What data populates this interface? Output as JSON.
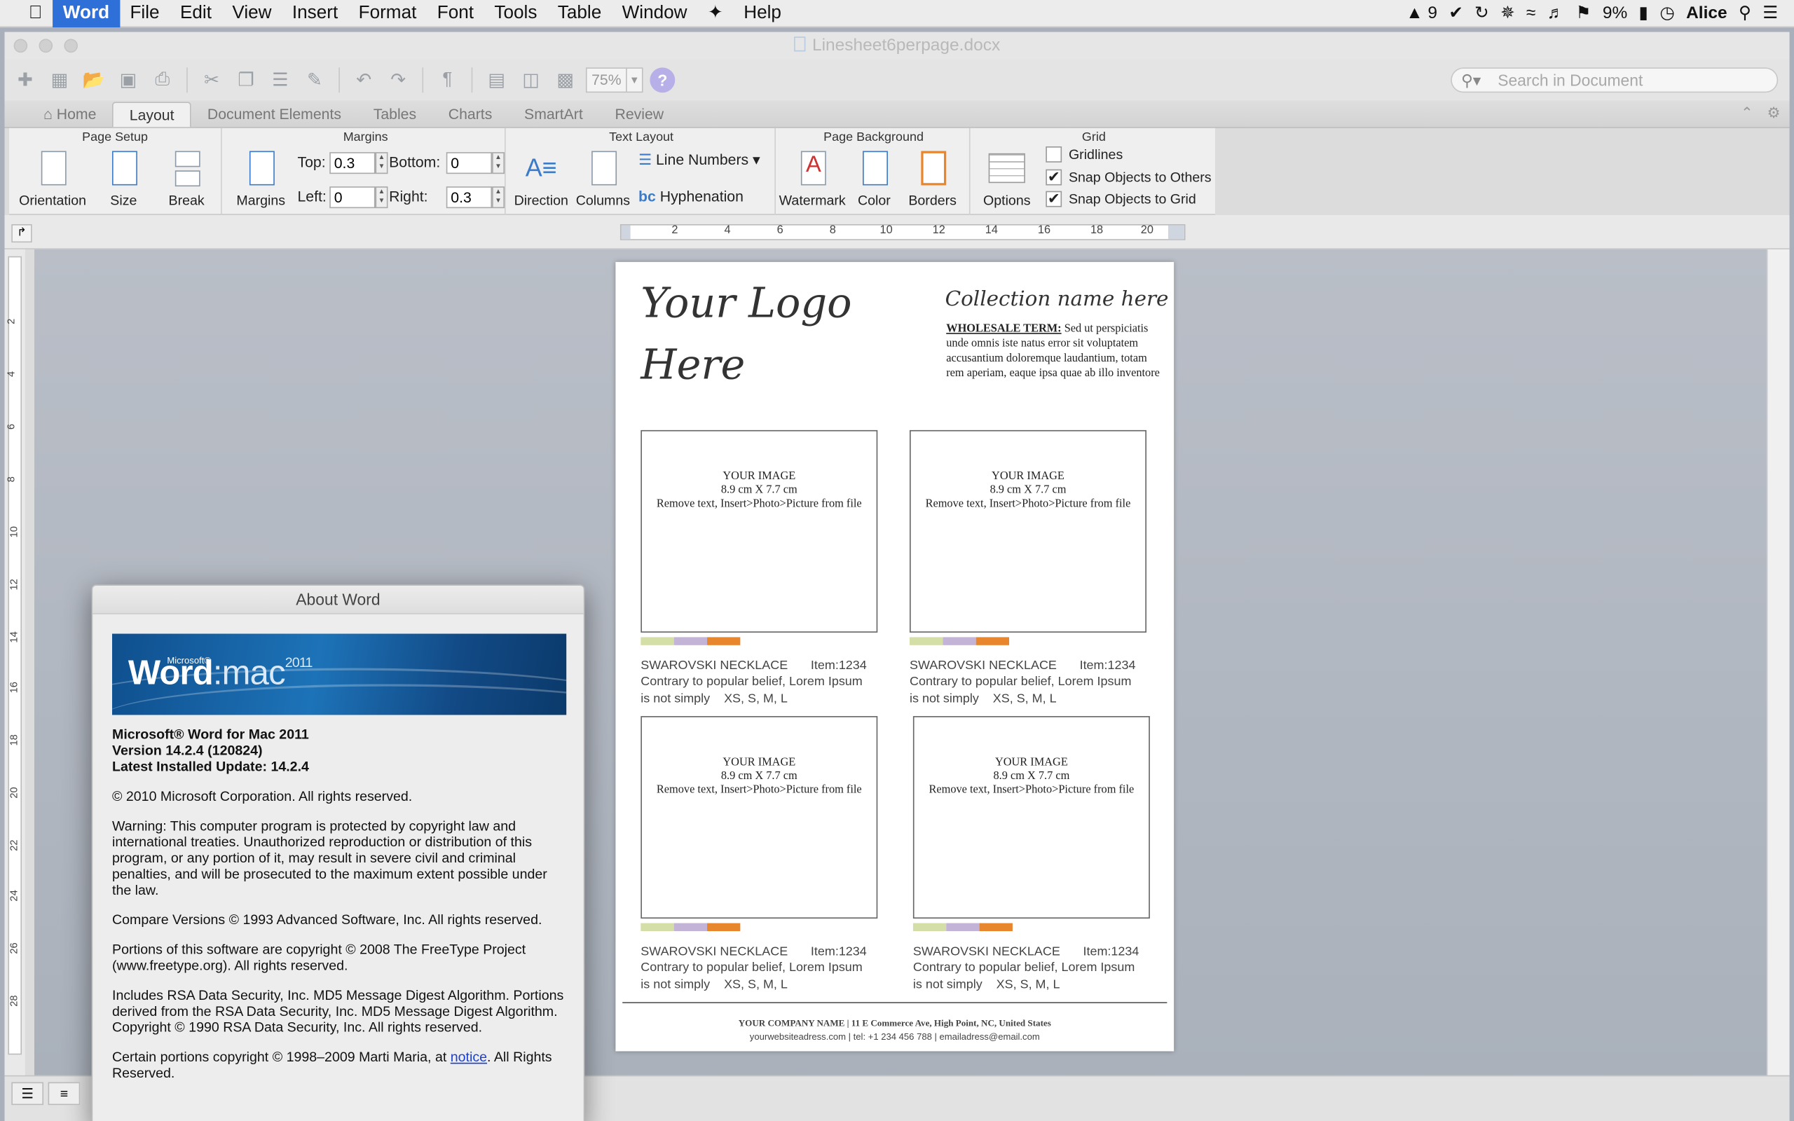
{
  "menubar": {
    "app": "Word",
    "items": [
      "File",
      "Edit",
      "View",
      "Insert",
      "Format",
      "Font",
      "Tools",
      "Table",
      "Window",
      "Help"
    ],
    "status": {
      "adobe": "9",
      "battery": "9%",
      "user": "Alice"
    }
  },
  "window": {
    "title": "Linesheet6perpage.docx",
    "zoom": "75%",
    "search_placeholder": "Search in Document"
  },
  "tabs": [
    "Home",
    "Layout",
    "Document Elements",
    "Tables",
    "Charts",
    "SmartArt",
    "Review"
  ],
  "ribbon": {
    "page_setup": {
      "title": "Page Setup",
      "orientation": "Orientation",
      "size": "Size",
      "break": "Break"
    },
    "margins": {
      "title": "Margins",
      "button": "Margins",
      "top_label": "Top:",
      "top": "0.3",
      "bottom_label": "Bottom:",
      "bottom": "0",
      "left_label": "Left:",
      "left": "0",
      "right_label": "Right:",
      "right": "0.3"
    },
    "text_layout": {
      "title": "Text Layout",
      "direction": "Direction",
      "columns": "Columns",
      "line_numbers": "Line Numbers",
      "hyphenation": "Hyphenation"
    },
    "page_background": {
      "title": "Page Background",
      "watermark": "Watermark",
      "color": "Color",
      "borders": "Borders"
    },
    "grid": {
      "title": "Grid",
      "options": "Options",
      "gridlines": "Gridlines",
      "snap_others": "Snap Objects to Others",
      "snap_grid": "Snap Objects to Grid"
    }
  },
  "ruler": {
    "h_numbers": [
      "2",
      "4",
      "6",
      "8",
      "10",
      "12",
      "14",
      "16",
      "18",
      "20"
    ],
    "v_numbers": [
      "2",
      "4",
      "6",
      "8",
      "10",
      "12",
      "14",
      "16",
      "18",
      "20",
      "22",
      "24",
      "26",
      "28"
    ]
  },
  "document": {
    "logo_line1": "Your Logo",
    "logo_line2": "Here",
    "collection": "Collection name here",
    "wholesale_label": "WHOLESALE TERM:",
    "wholesale_text": " Sed ut perspiciatis unde omnis iste natus error sit voluptatem accusantium doloremque laudantium, totam rem aperiam, eaque ipsa quae ab illo inventore",
    "products": [
      {
        "img1": "YOUR IMAGE",
        "img2": "8.9 cm X 7.7 cm",
        "img3": "Remove text, Insert>Photo>Picture from file",
        "name": "SWAROVSKI NECKLACE",
        "item": "Item:1234",
        "desc1": "Contrary to popular belief, Lorem Ipsum",
        "desc2": "is not simply    XS, S, M, L"
      },
      {
        "img1": "YOUR IMAGE",
        "img2": "8.9 cm X 7.7 cm",
        "img3": "Remove text, Insert>Photo>Picture from file",
        "name": "SWAROVSKI NECKLACE",
        "item": "Item:1234",
        "desc1": "Contrary to popular belief, Lorem Ipsum",
        "desc2": "is not simply    XS, S, M, L"
      },
      {
        "img1": "YOUR IMAGE",
        "img2": "8.9 cm X 7.7 cm",
        "img3": "Remove text, Insert>Photo>Picture from file",
        "name": "SWAROVSKI NECKLACE",
        "item": "Item:1234",
        "desc1": "Contrary to popular belief, Lorem Ipsum",
        "desc2": "is not simply    XS, S, M, L"
      },
      {
        "img1": "YOUR IMAGE",
        "img2": "8.9 cm X 7.7 cm",
        "img3": "Remove text, Insert>Photo>Picture from file",
        "name": "SWAROVSKI NECKLACE",
        "item": "Item:1234",
        "desc1": "Contrary to popular belief, Lorem Ipsum",
        "desc2": "is not simply    XS, S, M, L"
      }
    ],
    "swatch_colors": [
      "#d4dfa8",
      "#c3b3d6",
      "#e8862e"
    ],
    "footer_line1": "YOUR COMPANY NAME  |  11 E Commerce Ave, High Point, NC, United States",
    "footer_line2": "yourwebsiteadress.com  |  tel: +1 234 456 788  |  emailadress@email.com"
  },
  "about": {
    "title": "About Word",
    "banner_ms": "Microsoft®",
    "banner_word": "Word",
    "banner_mac": ":mac",
    "banner_year": "2011",
    "product": "Microsoft® Word for Mac 2011",
    "version": "Version 14.2.4 (120824)",
    "update": "Latest Installed Update: 14.2.4",
    "copyright": "© 2010 Microsoft Corporation. All rights reserved.",
    "warning": "Warning: This computer program is protected by copyright law and international treaties.  Unauthorized reproduction or distribution of this program, or any portion of it, may result in severe civil and criminal penalties, and will be prosecuted to the maximum extent possible under the law.",
    "compare": "Compare Versions © 1993 Advanced Software, Inc.  All rights reserved.",
    "freetype": "Portions of this software are copyright © 2008 The FreeType Project (www.freetype.org).  All rights reserved.",
    "rsa": "Includes RSA Data Security, Inc. MD5 Message Digest Algorithm. Portions derived from the RSA Data Security, Inc. MD5 Message Digest Algorithm.  Copyright © 1990 RSA Data Security, Inc. All rights reserved.",
    "marti_pre": "Certain portions copyright © 1998–2009  Marti Maria, at ",
    "marti_link": "notice",
    "marti_post": ".  All Rights Reserved."
  }
}
